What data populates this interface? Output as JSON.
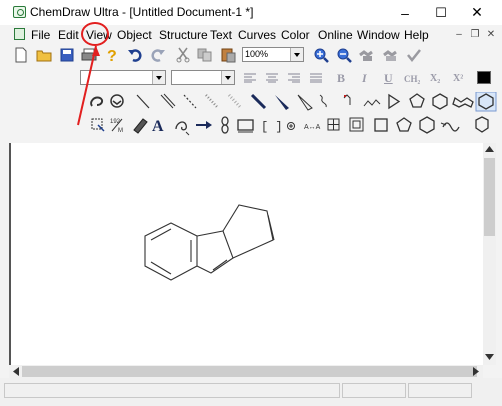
{
  "window": {
    "title": "ChemDraw Ultra - [Untitled Document-1 *]",
    "minimize_glyph": "–",
    "maximize_glyph": "☐",
    "close_glyph": "✕"
  },
  "menu": {
    "items": [
      "File",
      "Edit",
      "View",
      "Object",
      "Structure",
      "Text",
      "Curves",
      "Color",
      "Online",
      "Window",
      "Help"
    ],
    "mdi_minimize": "–",
    "mdi_restore": "❐",
    "mdi_close": "✕"
  },
  "toolbar": {
    "zoom_value": "100%",
    "icons": [
      "new-document-icon",
      "open-folder-icon",
      "save-icon",
      "print-icon",
      "help-icon",
      "undo-icon",
      "redo-icon",
      "cut-icon",
      "copy-icon",
      "paste-icon",
      "zoom-in-icon",
      "zoom-out-icon",
      "structure-check-icon",
      "clean-structure-icon",
      "checkmark-icon"
    ]
  },
  "format_bar": {
    "font_value": "",
    "size_value": "",
    "bold": "B",
    "italic": "I",
    "underline": "U",
    "formula": "CH₂",
    "subscript": "X₂",
    "superscript": "X²"
  },
  "annotation": {
    "highlight_color": "#e21f1f",
    "highlight_target": "View"
  },
  "colors": {
    "toolbar_bg": "#f3f3f3",
    "icon_blue": "#1f3f8f",
    "icon_red": "#c02020",
    "canvas_bg": "#ffffff"
  }
}
